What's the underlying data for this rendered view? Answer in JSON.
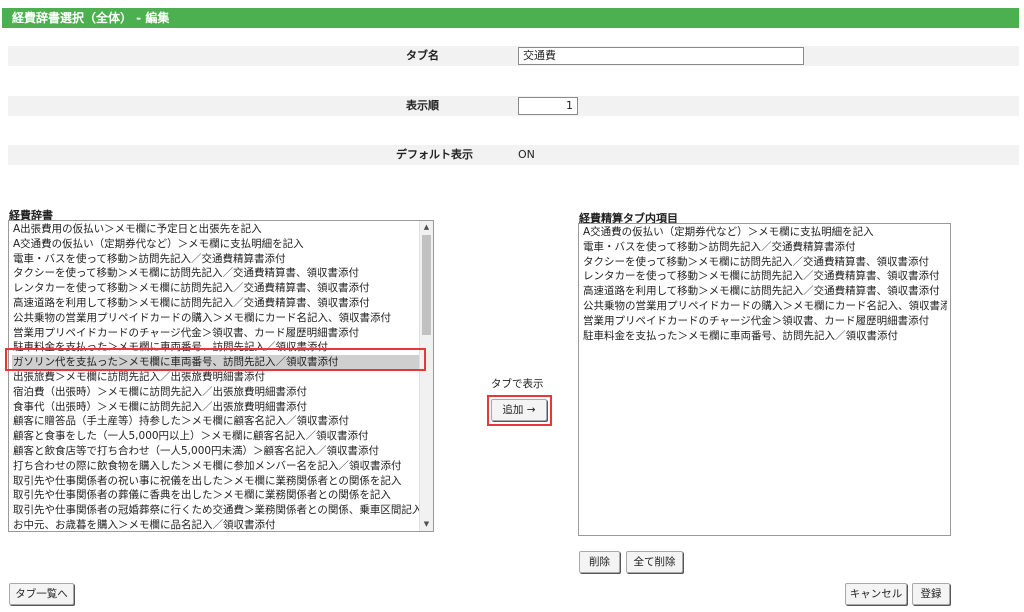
{
  "header": {
    "title": "経費辞書選択（全体） - 編集"
  },
  "form": {
    "tab_name_label": "タブ名",
    "tab_name_value": "交通費",
    "display_order_label": "表示順",
    "display_order_value": "1",
    "default_display_label": "デフォルト表示",
    "default_display_value": "ON"
  },
  "dictionary": {
    "label": "経費辞書",
    "items": [
      "A出張費用の仮払い＞メモ欄に予定日と出張先を記入",
      "A交通費の仮払い（定期券代など）＞メモ欄に支払明細を記入",
      "電車・バスを使って移動＞訪問先記入／交通費精算書添付",
      "タクシーを使って移動＞メモ欄に訪問先記入／交通費精算書、領収書添付",
      "レンタカーを使って移動＞メモ欄に訪問先記入／交通費精算書、領収書添付",
      "高速道路を利用して移動＞メモ欄に訪問先記入／交通費精算書、領収書添付",
      "公共乗物の営業用プリペイドカードの購入＞メモ欄にカード名記入、領収書添付",
      "営業用プリペイドカードのチャージ代金＞領収書、カード履歴明細書添付",
      "駐車料金を支払った＞メモ欄に車両番号、訪問先記入／領収書添付",
      "ガソリン代を支払った＞メモ欄に車両番号、訪問先記入／領収書添付",
      "出張旅費＞メモ欄に訪問先記入／出張旅費明細書添付",
      "宿泊費（出張時）＞メモ欄に訪問先記入／出張旅費明細書添付",
      "食事代（出張時）＞メモ欄に訪問先記入／出張旅費明細書添付",
      "顧客に贈答品（手土産等）持参した＞メモ欄に顧客名記入／領収書添付",
      "顧客と食事をした（一人5,000円以上）＞メモ欄に顧客名記入／領収書添付",
      "顧客と飲食店等で打ち合わせ（一人5,000円未満）＞顧客名記入／領収書添付",
      "打ち合わせの際に飲食物を購入した＞メモ欄に参加メンバー名を記入／領収書添付",
      "取引先や仕事関係者の祝い事に祝儀を出した＞メモ欄に業務関係者との関係を記入",
      "取引先や仕事関係者の葬儀に香典を出した＞メモ欄に業務関係者との関係を記入",
      "取引先や仕事関係者の冠婚葬祭に行くため交通費＞業務関係者との関係、乗車区間記入",
      "お中元、お歳暮を購入＞メモ欄に品名記入／領収書添付"
    ],
    "selected_index": 9
  },
  "add_button": {
    "caption": "タブで表示",
    "label": "追加 →"
  },
  "tab_items": {
    "label": "経費精算タブ内項目",
    "items": [
      "A交通費の仮払い（定期券代など）＞メモ欄に支払明細を記入",
      "電車・バスを使って移動＞訪問先記入／交通費精算書添付",
      "タクシーを使って移動＞メモ欄に訪問先記入／交通費精算書、領収書添付",
      "レンタカーを使って移動＞メモ欄に訪問先記入／交通費精算書、領収書添付",
      "高速道路を利用して移動＞メモ欄に訪問先記入／交通費精算書、領収書添付",
      "公共乗物の営業用プリペイドカードの購入＞メモ欄にカード名記入、領収書添付",
      "営業用プリペイドカードのチャージ代金＞領収書、カード履歴明細書添付",
      "駐車料金を支払った＞メモ欄に車両番号、訪問先記入／領収書添付"
    ]
  },
  "buttons": {
    "delete": "削除",
    "delete_all": "全て削除",
    "tab_list": "タブ一覧へ",
    "cancel": "キャンセル",
    "register": "登録"
  },
  "colors": {
    "header_bg": "#4caf50",
    "highlight": "#e53935"
  },
  "icons": {
    "scroll_up": "triangle-up",
    "scroll_down": "triangle-down"
  }
}
